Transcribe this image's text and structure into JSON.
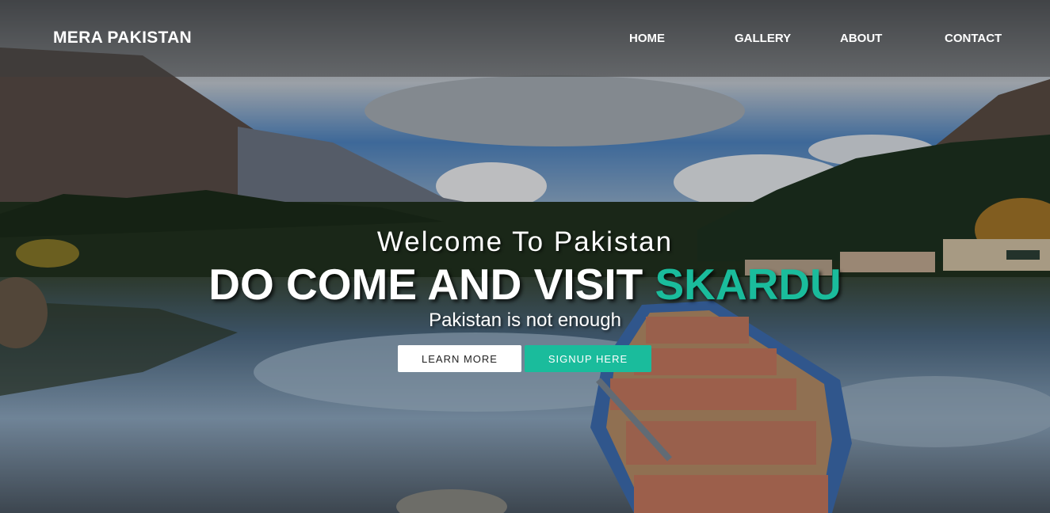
{
  "brand": "MERA PAKISTAN",
  "nav": {
    "home": "HOME",
    "gallery": "GALLERY",
    "about": "ABOUT",
    "contact": "CONTACT"
  },
  "hero": {
    "welcome": "Welcome To Pakistan",
    "headline_main": "DO COME AND VISIT ",
    "headline_accent": "SKARDU",
    "tagline": "Pakistan is not enough",
    "learn_more": "LEARN MORE",
    "signup": "SIGNUP HERE"
  },
  "colors": {
    "accent": "#1abc9c",
    "nav_bg": "rgba(60,60,60,0.55)",
    "text": "#ffffff"
  },
  "background_image": "mountain-lake-boat-scene"
}
